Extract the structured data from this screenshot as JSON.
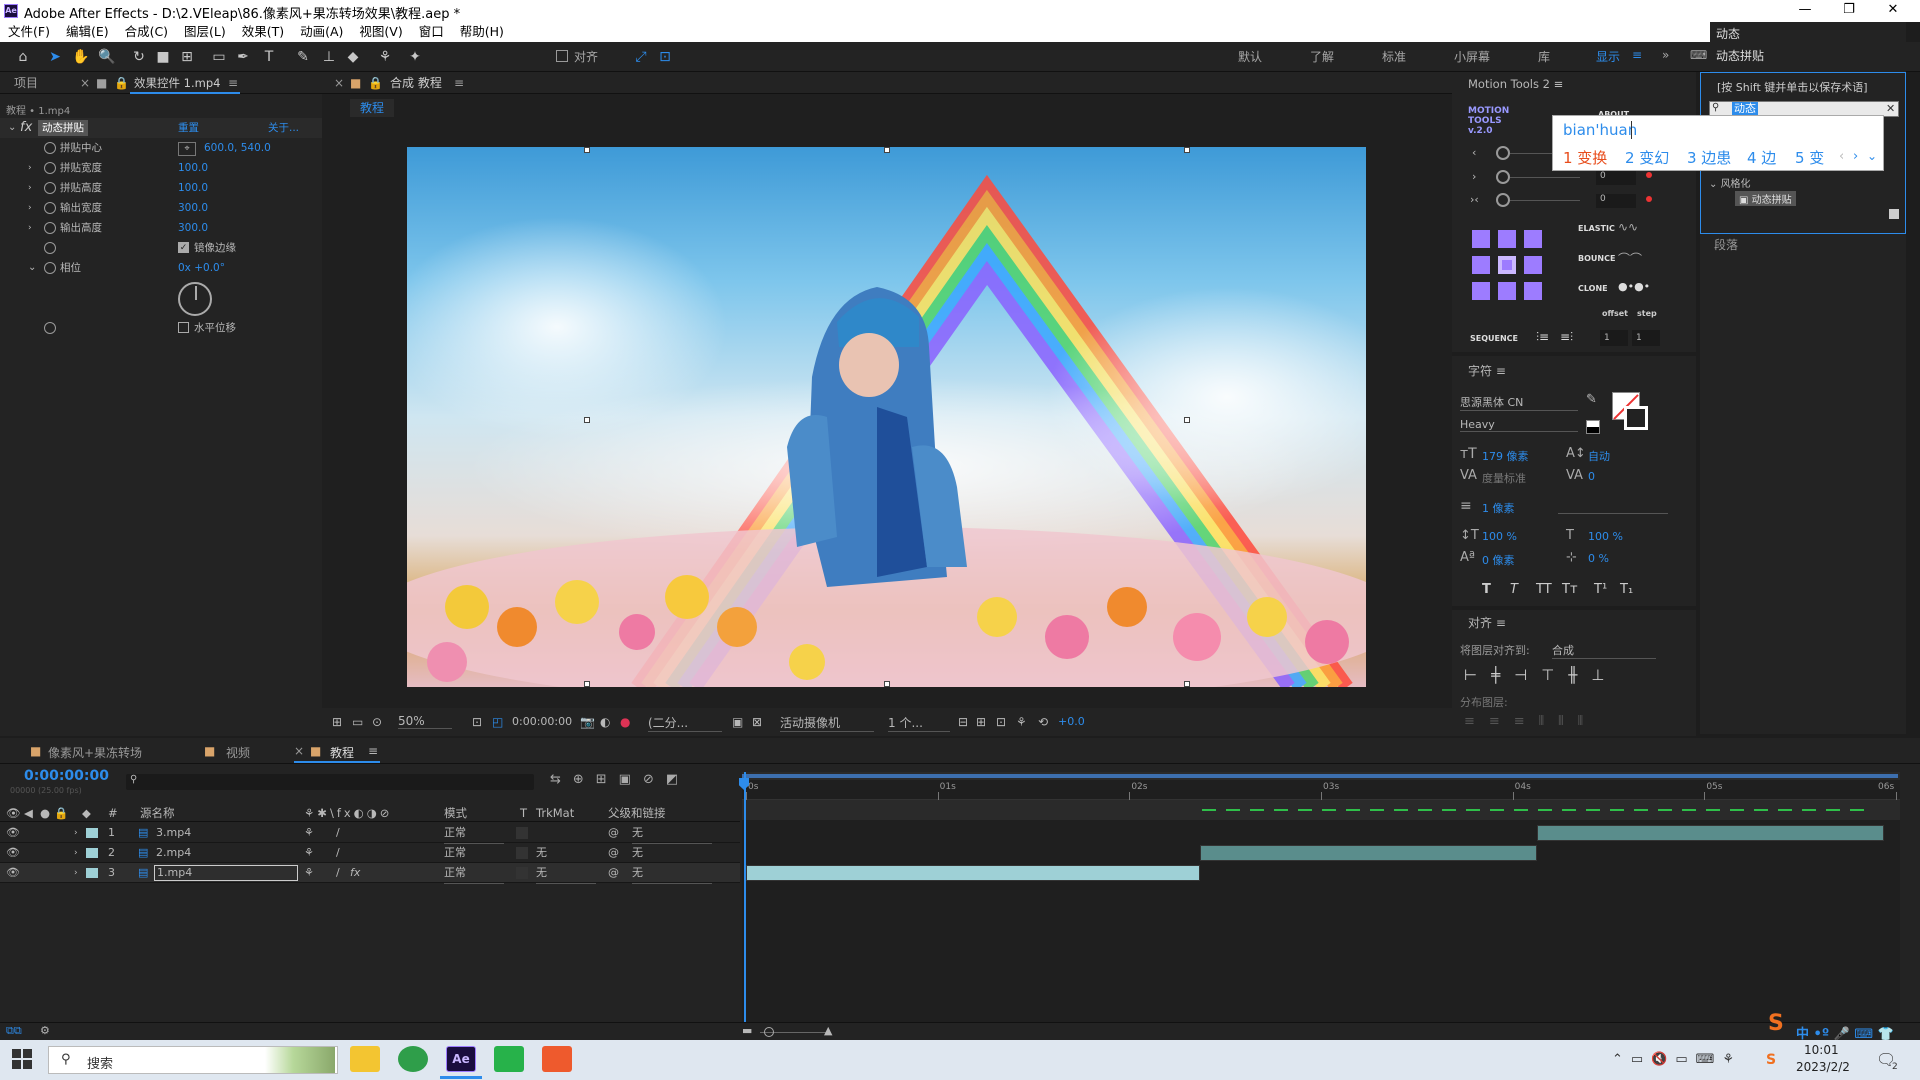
{
  "window": {
    "title": "Adobe After Effects - D:\\2.VEleap\\86.像素风+果冻转场效果\\教程.aep *",
    "app_badge": "Ae"
  },
  "menu": [
    "文件(F)",
    "编辑(E)",
    "合成(C)",
    "图层(L)",
    "效果(T)",
    "动画(A)",
    "视图(V)",
    "窗口",
    "帮助(H)"
  ],
  "toolbar": {
    "align_label": "对齐",
    "workspaces": [
      "默认",
      "了解",
      "标准",
      "小屏幕",
      "库",
      "显示"
    ],
    "active_workspace": "显示"
  },
  "search_panel": {
    "items": [
      "动态",
      "动态拼贴"
    ],
    "hint": "[按 Shift 键并单击以保存术语]",
    "query": "动态",
    "tree_group": "风格化",
    "tree_item": "动态拼贴"
  },
  "paragraph_panel": {
    "title": "段落"
  },
  "ime": {
    "pinyin": "bian'huan",
    "candidates": [
      "1 变换",
      "2 变幻",
      "3 边患",
      "4 边",
      "5 变"
    ]
  },
  "left_panel": {
    "tabs": [
      "项目",
      "效果控件 1.mp4"
    ],
    "breadcrumb": "教程 • 1.mp4",
    "fx_name": "动态拼贴",
    "reset": "重置",
    "about": "关于...",
    "props": [
      {
        "name": "拼贴中心",
        "value": "600.0, 540.0"
      },
      {
        "name": "拼贴宽度",
        "value": "100.0"
      },
      {
        "name": "拼贴高度",
        "value": "100.0"
      },
      {
        "name": "输出宽度",
        "value": "300.0"
      },
      {
        "name": "输出高度",
        "value": "300.0"
      }
    ],
    "mirror_label": "镜像边缘",
    "mirror_checked": true,
    "phase_name": "相位",
    "phase_value": "0x +0.0°",
    "hshift_label": "水平位移"
  },
  "comp_panel": {
    "tab": "合成 教程",
    "subtab": "教程",
    "footer": {
      "zoom": "50%",
      "time": "0:00:00:00",
      "resolution": "(二分...",
      "camera": "活动摄像机",
      "views": "1 个...",
      "exposure": "+0.0"
    }
  },
  "motion_tools": {
    "title": "Motion Tools 2",
    "logo": "MOTION TOOLS v.2.0",
    "about": "ABOUT",
    "slider_values": [
      "0",
      "0",
      "0"
    ],
    "buttons": [
      "ELASTIC",
      "BOUNCE",
      "CLONE"
    ],
    "offset": "offset",
    "step": "step",
    "sequence": "SEQUENCE",
    "seq_values": [
      "1",
      "1"
    ]
  },
  "char_panel": {
    "title": "字符",
    "font": "思源黑体 CN",
    "style": "Heavy",
    "size": "179 像素",
    "leading": "自动",
    "kerning": "度量标准",
    "tracking": "0",
    "stroke": "1 像素",
    "vscale": "100 %",
    "hscale": "100 %",
    "baseline": "0 像素",
    "tsume": "0 %",
    "style_buttons": [
      "T",
      "T",
      "TT",
      "Tт",
      "T¹",
      "T₁"
    ]
  },
  "align_panel": {
    "title": "对齐",
    "align_to_label": "将图层对齐到:",
    "align_to": "合成",
    "distribute": "分布图层:"
  },
  "timeline": {
    "tabs": [
      "像素风+果冻转场",
      "视频",
      "教程"
    ],
    "active_tab": "教程",
    "timecode": "0:00:00:00",
    "timecode_sub": "00000 (25.00 fps)",
    "columns": {
      "num": "#",
      "name": "源名称",
      "mode": "模式",
      "t": "T",
      "trkmat": "TrkMat",
      "parent": "父级和链接"
    },
    "ruler": [
      "0s",
      "01s",
      "02s",
      "03s",
      "04s",
      "05s",
      "06s"
    ],
    "layers": [
      {
        "num": "1",
        "name": "3.mp4",
        "mode": "正常",
        "trkmat": "",
        "parent": "无",
        "start": 0.688,
        "end": 0.99
      },
      {
        "num": "2",
        "name": "2.mp4",
        "mode": "正常",
        "trkmat": "无",
        "parent": "无",
        "start": 0.395,
        "end": 0.688
      },
      {
        "num": "3",
        "name": "1.mp4",
        "mode": "正常",
        "trkmat": "无",
        "parent": "无",
        "start": 0.0,
        "end": 0.395
      }
    ]
  },
  "taskbar": {
    "search": "搜索",
    "time": "10:01",
    "date": "2023/2/2",
    "ime_lang": "中",
    "notif_count": "2"
  },
  "colors": {
    "accent": "#2d8ceb",
    "ae_purple": "#9999ff",
    "clip_teal": "#5a8d8c",
    "clip_blue": "#9ed0d6"
  }
}
